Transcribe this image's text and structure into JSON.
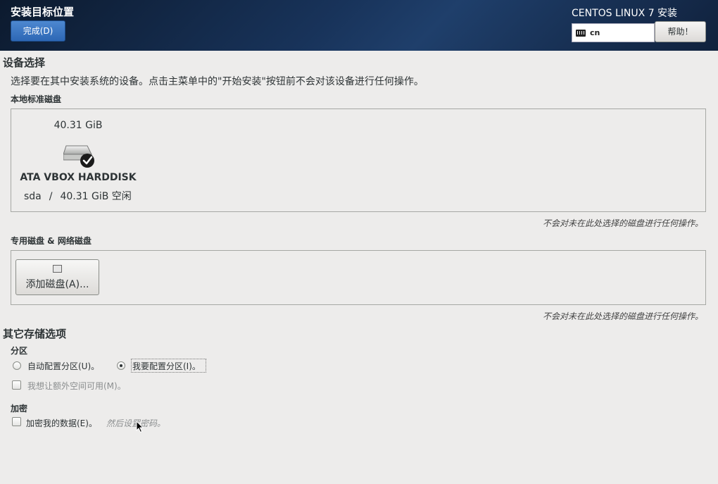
{
  "header": {
    "title": "安装目标位置",
    "done_label": "完成(D)",
    "product": "CENTOS LINUX 7 安装",
    "keyboard_layout": "cn",
    "help_label": "帮助！"
  },
  "device_selection": {
    "heading": "设备选择",
    "description": "选择要在其中安装系统的设备。点击主菜单中的\"开始安装\"按钮前不会对该设备进行任何操作。",
    "local_disks_heading": "本地标准磁盘",
    "disk": {
      "size": "40.31 GiB",
      "name": "ATA VBOX HARDDISK",
      "device": "sda",
      "separator": "/",
      "free": "40.31 GiB 空闲",
      "selected": true
    },
    "local_note": "不会对未在此处选择的磁盘进行任何操作。",
    "specialized_heading": "专用磁盘 & 网络磁盘",
    "add_disk_label": "添加磁盘(A)...",
    "specialized_note": "不会对未在此处选择的磁盘进行任何操作。"
  },
  "other_storage": {
    "heading": "其它存储选项",
    "partitioning_heading": "分区",
    "auto_label": "自动配置分区(U)。",
    "manual_label": "我要配置分区(I)。",
    "manual_selected": true,
    "extra_space_label": "我想让额外空间可用(M)。",
    "encryption_heading": "加密",
    "encrypt_label": "加密我的数据(E)。",
    "encrypt_hint": "然后设置密码。"
  },
  "icons": {
    "keyboard": "keyboard-icon",
    "disk": "harddisk-icon",
    "checkmark": "checkmark-icon",
    "add_disk": "add-disk-icon",
    "pointer": "mouse-pointer-icon"
  },
  "colors": {
    "header_bg": "#18335a",
    "done_button": "#2d67b5",
    "page_bg": "#edeceb"
  }
}
